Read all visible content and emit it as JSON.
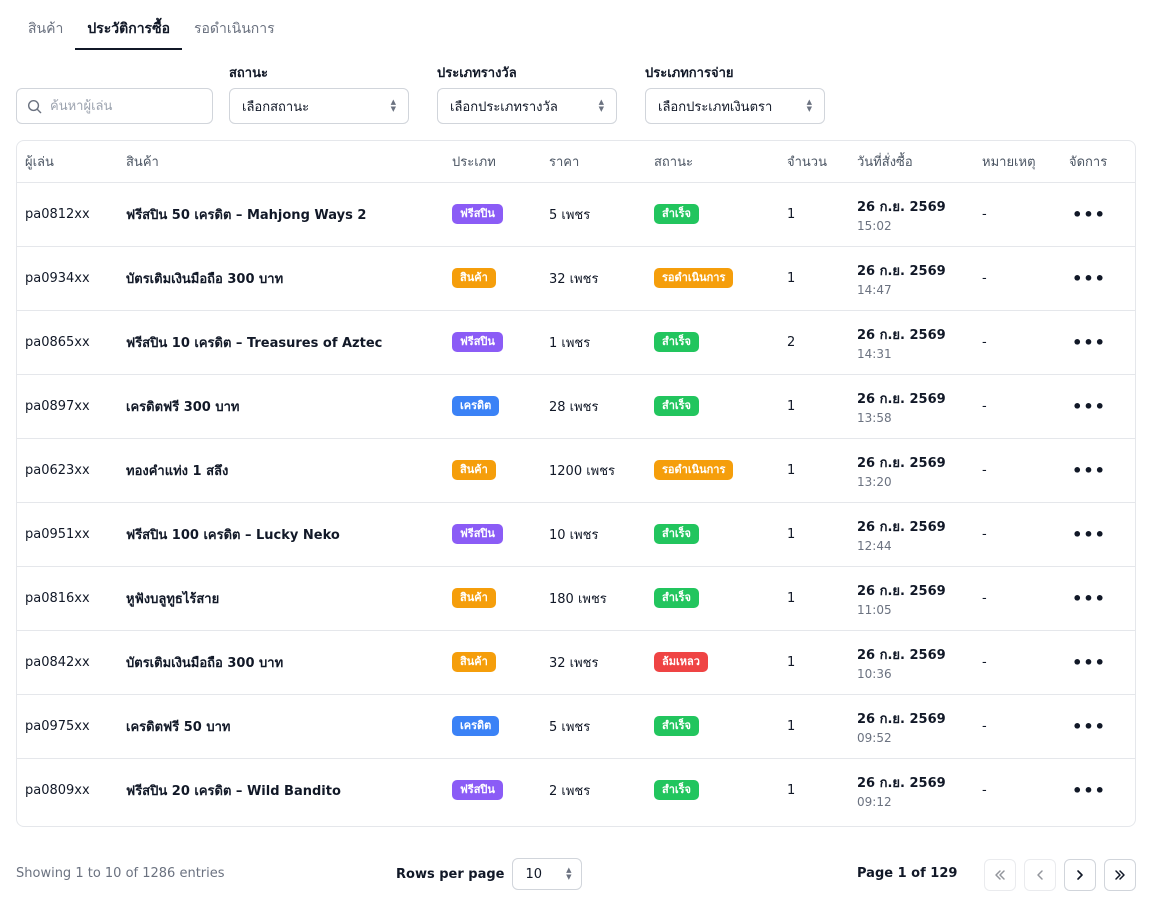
{
  "tabs": [
    {
      "label": "สินค้า",
      "active": false
    },
    {
      "label": "ประวัติการซื้อ",
      "active": true
    },
    {
      "label": "รอดำเนินการ",
      "active": false
    }
  ],
  "filters": {
    "search_placeholder": "ค้นหาผู้เล่น",
    "status": {
      "label": "สถานะ",
      "value": "เลือกสถานะ"
    },
    "reward_type": {
      "label": "ประเภทรางวัล",
      "value": "เลือกประเภทรางวัล"
    },
    "payment_type": {
      "label": "ประเภทการจ่าย",
      "value": "เลือกประเภทเงินตรา"
    }
  },
  "table": {
    "headers": [
      "ผู้เล่น",
      "สินค้า",
      "ประเภท",
      "ราคา",
      "สถานะ",
      "จำนวน",
      "วันที่สั่งซื้อ",
      "หมายเหตุ",
      "จัดการ"
    ],
    "rows": [
      {
        "player": "pa0812xx",
        "product": "ฟรีสปิน 50 เครดิต – Mahjong Ways 2",
        "type": "ฟรีสปิน",
        "type_color": "#8b5cf6",
        "price": "5 เพชร",
        "status": "สำเร็จ",
        "status_color": "#22c55e",
        "qty": "1",
        "date": "26 ก.ย. 2569",
        "time": "15:02",
        "note": "-"
      },
      {
        "player": "pa0934xx",
        "product": "บัตรเติมเงินมือถือ 300 บาท",
        "type": "สินค้า",
        "type_color": "#f59e0b",
        "price": "32 เพชร",
        "status": "รอดำเนินการ",
        "status_color": "#f59e0b",
        "qty": "1",
        "date": "26 ก.ย. 2569",
        "time": "14:47",
        "note": "-"
      },
      {
        "player": "pa0865xx",
        "product": "ฟรีสปิน 10 เครดิต – Treasures of Aztec",
        "type": "ฟรีสปิน",
        "type_color": "#8b5cf6",
        "price": "1 เพชร",
        "status": "สำเร็จ",
        "status_color": "#22c55e",
        "qty": "2",
        "date": "26 ก.ย. 2569",
        "time": "14:31",
        "note": "-"
      },
      {
        "player": "pa0897xx",
        "product": "เครดิตฟรี 300 บาท",
        "type": "เครดิต",
        "type_color": "#3b82f6",
        "price": "28 เพชร",
        "status": "สำเร็จ",
        "status_color": "#22c55e",
        "qty": "1",
        "date": "26 ก.ย. 2569",
        "time": "13:58",
        "note": "-"
      },
      {
        "player": "pa0623xx",
        "product": "ทองคำแท่ง 1 สลึง",
        "type": "สินค้า",
        "type_color": "#f59e0b",
        "price": "1200 เพชร",
        "status": "รอดำเนินการ",
        "status_color": "#f59e0b",
        "qty": "1",
        "date": "26 ก.ย. 2569",
        "time": "13:20",
        "note": "-"
      },
      {
        "player": "pa0951xx",
        "product": "ฟรีสปิน 100 เครดิต – Lucky Neko",
        "type": "ฟรีสปิน",
        "type_color": "#8b5cf6",
        "price": "10 เพชร",
        "status": "สำเร็จ",
        "status_color": "#22c55e",
        "qty": "1",
        "date": "26 ก.ย. 2569",
        "time": "12:44",
        "note": "-"
      },
      {
        "player": "pa0816xx",
        "product": "หูฟังบลูทูธไร้สาย",
        "type": "สินค้า",
        "type_color": "#f59e0b",
        "price": "180 เพชร",
        "status": "สำเร็จ",
        "status_color": "#22c55e",
        "qty": "1",
        "date": "26 ก.ย. 2569",
        "time": "11:05",
        "note": "-"
      },
      {
        "player": "pa0842xx",
        "product": "บัตรเติมเงินมือถือ 300 บาท",
        "type": "สินค้า",
        "type_color": "#f59e0b",
        "price": "32 เพชร",
        "status": "ล้มเหลว",
        "status_color": "#ef4444",
        "qty": "1",
        "date": "26 ก.ย. 2569",
        "time": "10:36",
        "note": "-"
      },
      {
        "player": "pa0975xx",
        "product": "เครดิตฟรี 50 บาท",
        "type": "เครดิต",
        "type_color": "#3b82f6",
        "price": "5 เพชร",
        "status": "สำเร็จ",
        "status_color": "#22c55e",
        "qty": "1",
        "date": "26 ก.ย. 2569",
        "time": "09:52",
        "note": "-"
      },
      {
        "player": "pa0809xx",
        "product": "ฟรีสปิน 20 เครดิต – Wild Bandito",
        "type": "ฟรีสปิน",
        "type_color": "#8b5cf6",
        "price": "2 เพชร",
        "status": "สำเร็จ",
        "status_color": "#22c55e",
        "qty": "1",
        "date": "26 ก.ย. 2569",
        "time": "09:12",
        "note": "-"
      }
    ]
  },
  "footer": {
    "showing": "Showing 1 to 10 of 1286 entries",
    "rows_per_page_label": "Rows per page",
    "rows_per_page_value": "10",
    "page_info": "Page 1 of 129"
  }
}
